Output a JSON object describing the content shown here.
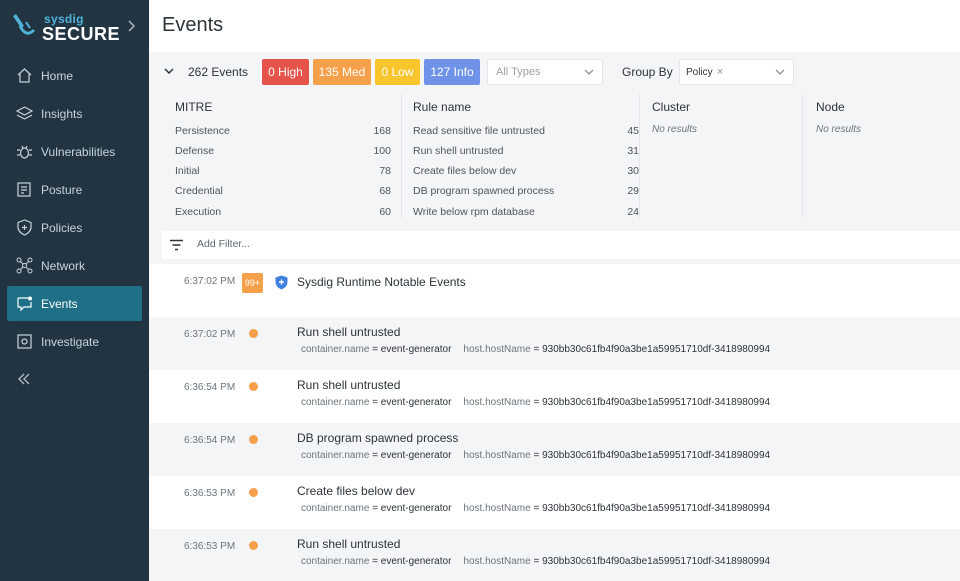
{
  "sidebar": {
    "brand_small": "sysdig",
    "brand_big": "SECURE",
    "items": [
      {
        "label": "Home",
        "icon": "home-icon"
      },
      {
        "label": "Insights",
        "icon": "layers-icon"
      },
      {
        "label": "Vulnerabilities",
        "icon": "bug-icon"
      },
      {
        "label": "Posture",
        "icon": "checklist-icon"
      },
      {
        "label": "Policies",
        "icon": "shield-plus-icon"
      },
      {
        "label": "Network",
        "icon": "network-icon"
      },
      {
        "label": "Events",
        "icon": "chat-alert-icon",
        "active": true
      },
      {
        "label": "Investigate",
        "icon": "scan-icon"
      }
    ],
    "colors": {
      "bg": "#223442",
      "active": "#1f6f86",
      "accent": "#4fb3d9"
    }
  },
  "page": {
    "title": "Events"
  },
  "filters": {
    "events_count": "262 Events",
    "high": "0 High",
    "med": "135 Med",
    "low": "0 Low",
    "info": "127 Info",
    "types_placeholder": "All Types",
    "group_by_label": "Group By",
    "group_by_chip": "Policy",
    "group_by_chip_remove": "×",
    "severity_colors": {
      "high": "#e5534b",
      "med": "#f7a04b",
      "low": "#f8c52c",
      "info": "#6e93e8"
    }
  },
  "summary": {
    "mitre": {
      "header": "MITRE",
      "rows": [
        {
          "label": "Persistence",
          "count": "168"
        },
        {
          "label": "Defense",
          "count": "100"
        },
        {
          "label": "Initial",
          "count": "78"
        },
        {
          "label": "Credential",
          "count": "68"
        },
        {
          "label": "Execution",
          "count": "60"
        }
      ]
    },
    "rule": {
      "header": "Rule name",
      "rows": [
        {
          "label": "Read sensitive file untrusted",
          "count": "45"
        },
        {
          "label": "Run shell untrusted",
          "count": "31"
        },
        {
          "label": "Create files below dev",
          "count": "30"
        },
        {
          "label": "DB program spawned process",
          "count": "29"
        },
        {
          "label": "Write below rpm database",
          "count": "24"
        }
      ]
    },
    "cluster": {
      "header": "Cluster",
      "empty": "No results"
    },
    "node": {
      "header": "Node",
      "empty": "No results"
    }
  },
  "add_filter": {
    "placeholder": "Add Filter..."
  },
  "group": {
    "time": "6:37:02 PM",
    "badge": "99+",
    "title": "Sysdig Runtime Notable Events"
  },
  "events": [
    {
      "time": "6:37:02 PM",
      "title": "Run shell untrusted",
      "k1": "container.name",
      "v1": "event-generator",
      "k2": "host.hostName",
      "v2": "930bb30c61fb4f90a3be1a59951710df-3418980994"
    },
    {
      "time": "6:36:54 PM",
      "title": "Run shell untrusted",
      "k1": "container.name",
      "v1": "event-generator",
      "k2": "host.hostName",
      "v2": "930bb30c61fb4f90a3be1a59951710df-3418980994"
    },
    {
      "time": "6:36:54 PM",
      "title": "DB program spawned process",
      "k1": "container.name",
      "v1": "event-generator",
      "k2": "host.hostName",
      "v2": "930bb30c61fb4f90a3be1a59951710df-3418980994"
    },
    {
      "time": "6:36:53 PM",
      "title": "Create files below dev",
      "k1": "container.name",
      "v1": "event-generator",
      "k2": "host.hostName",
      "v2": "930bb30c61fb4f90a3be1a59951710df-3418980994"
    },
    {
      "time": "6:36:53 PM",
      "title": "Run shell untrusted",
      "k1": "container.name",
      "v1": "event-generator",
      "k2": "host.hostName",
      "v2": "930bb30c61fb4f90a3be1a59951710df-3418980994"
    }
  ],
  "eq": "="
}
